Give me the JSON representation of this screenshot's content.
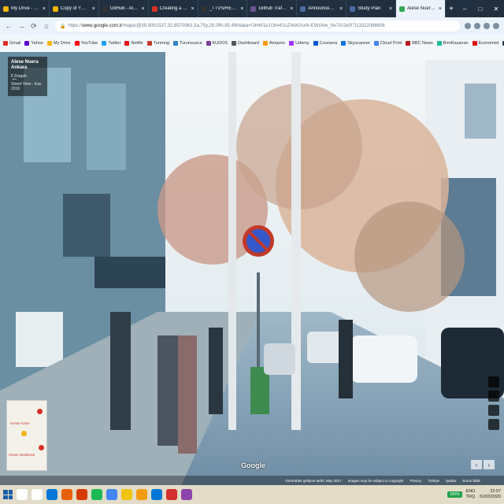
{
  "browser": {
    "tabs": [
      {
        "title": "My Drive - Google",
        "color": "#f4b400"
      },
      {
        "title": "Copy of YOLOv3_Tu",
        "color": "#f4b400"
      },
      {
        "title": "GitHub - AlexeyAB/Yolo",
        "color": "#333333"
      },
      {
        "title": "Creating a YOLOv3",
        "color": "#d93025"
      },
      {
        "title": "_TTVS/README.md",
        "color": "#333333"
      },
      {
        "title": "Github Traffic Signs",
        "color": "#6e5494"
      },
      {
        "title": "Announcements -",
        "color": "#4a6aa5"
      },
      {
        "title": "Study Plan",
        "color": "#4a6aa5"
      },
      {
        "title": "Alese Nuera Ankara",
        "color": "#34a853",
        "active": true
      }
    ],
    "new_tab": "+",
    "window_controls": [
      "–",
      "□",
      "✕"
    ],
    "address": {
      "scheme": "https://",
      "host": "www.google.com.tr",
      "path": "/maps/@39.9091537,32.8570963,3a,75y,28.09h,95.49t/data=!3m6!1e1!3m4!1sZ4cK0sxN-EWsNw_Nv7A!2e0!7i13312!8i6656"
    },
    "bookmarks": [
      {
        "label": "Gmail",
        "color": "#d93025"
      },
      {
        "label": "Yahoo",
        "color": "#6001d2"
      },
      {
        "label": "My Drive",
        "color": "#f4b400"
      },
      {
        "label": "YouTube",
        "color": "#ff0000"
      },
      {
        "label": "Twitter",
        "color": "#1da1f2"
      },
      {
        "label": "Netflix",
        "color": "#e50914"
      },
      {
        "label": "Turenng",
        "color": "#c0392b"
      },
      {
        "label": "Turunsuzca",
        "color": "#2e86c1"
      },
      {
        "label": "KUDOS",
        "color": "#7d3c98"
      },
      {
        "label": "Dashboard",
        "color": "#555555"
      },
      {
        "label": "Amazon",
        "color": "#ff9900"
      },
      {
        "label": "Udemy",
        "color": "#a435f0"
      },
      {
        "label": "Coursera",
        "color": "#0056d2"
      },
      {
        "label": "Skyscanner",
        "color": "#0770e3"
      },
      {
        "label": "Cloud Print",
        "color": "#4285f4"
      },
      {
        "label": "BBC News",
        "color": "#bb1919"
      },
      {
        "label": "BrmKazanan",
        "color": "#1abc9c"
      },
      {
        "label": "Economist",
        "color": "#e3120b"
      },
      {
        "label": "Ebvs",
        "color": "#2c3e50"
      },
      {
        "label": "Codecademy",
        "color": "#1f4056"
      },
      {
        "label": "Documentary",
        "color": "#333333"
      }
    ]
  },
  "streetview": {
    "place_name": "Alese Nuera Ankara",
    "subtitle": "İl Zorgah",
    "date_label": "Street View - Kas 2016",
    "minimap": {
      "labels": [
        "Kenar Kosei",
        "Havai Hardanesi"
      ]
    },
    "google_logo": "Google",
    "footer": [
      "Görüntüler gelişme tarihi: May 2017",
      "Images may be subject to copyright",
      "Privacy",
      "Türkiye",
      "Şartlar",
      "Sorun bildir"
    ]
  },
  "taskbar": {
    "apps": [
      {
        "name": "search",
        "color": "#ffffff"
      },
      {
        "name": "task-view",
        "color": "#ffffff"
      },
      {
        "name": "edge",
        "color": "#0078d7"
      },
      {
        "name": "firefox",
        "color": "#e66000"
      },
      {
        "name": "office",
        "color": "#d83b01"
      },
      {
        "name": "spotify",
        "color": "#1db954"
      },
      {
        "name": "chrome",
        "color": "#4285f4"
      },
      {
        "name": "file-explorer",
        "color": "#f1c40f"
      },
      {
        "name": "folder",
        "color": "#f39c12"
      },
      {
        "name": "mail",
        "color": "#0078d7"
      },
      {
        "name": "acrobat",
        "color": "#d32f2f"
      },
      {
        "name": "app-s",
        "color": "#8e44ad"
      }
    ],
    "battery": "100%",
    "lang_top": "ENG",
    "lang_bottom": "TRQ",
    "time": "22:07",
    "date": "31/03/2020"
  }
}
